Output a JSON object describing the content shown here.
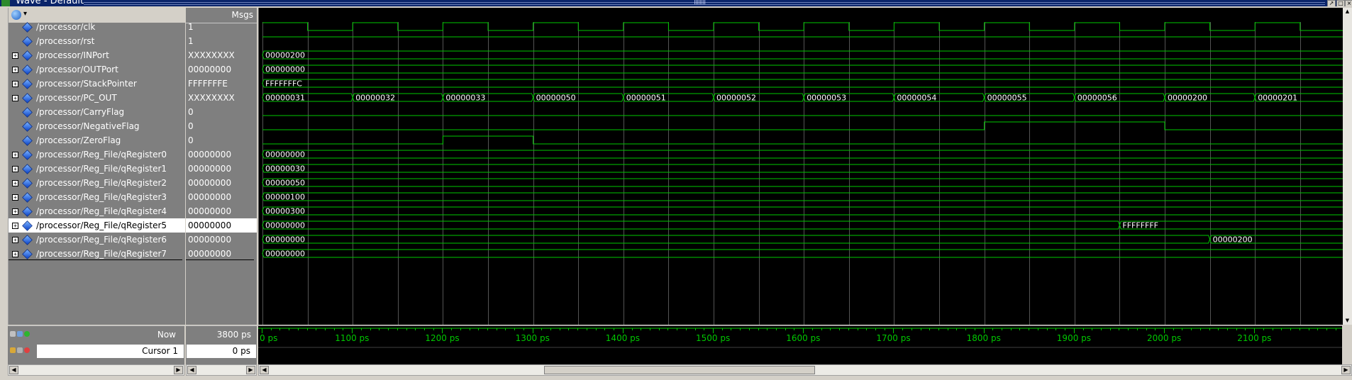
{
  "window": {
    "title": "Wave - Default"
  },
  "columns": {
    "values_header": "Msgs"
  },
  "signals": [
    {
      "name": "/processor/clk",
      "value": "1",
      "expandable": false
    },
    {
      "name": "/processor/rst",
      "value": "1",
      "expandable": false
    },
    {
      "name": "/processor/INPort",
      "value": "XXXXXXXX",
      "expandable": true
    },
    {
      "name": "/processor/OUTPort",
      "value": "00000000",
      "expandable": true
    },
    {
      "name": "/processor/StackPointer",
      "value": "FFFFFFFE",
      "expandable": true
    },
    {
      "name": "/processor/PC_OUT",
      "value": "XXXXXXXX",
      "expandable": true
    },
    {
      "name": "/processor/CarryFlag",
      "value": "0",
      "expandable": false
    },
    {
      "name": "/processor/NegativeFlag",
      "value": "0",
      "expandable": false
    },
    {
      "name": "/processor/ZeroFlag",
      "value": "0",
      "expandable": false
    },
    {
      "name": "/processor/Reg_File/qRegister0",
      "value": "00000000",
      "expandable": true
    },
    {
      "name": "/processor/Reg_File/qRegister1",
      "value": "00000000",
      "expandable": true
    },
    {
      "name": "/processor/Reg_File/qRegister2",
      "value": "00000000",
      "expandable": true
    },
    {
      "name": "/processor/Reg_File/qRegister3",
      "value": "00000000",
      "expandable": true
    },
    {
      "name": "/processor/Reg_File/qRegister4",
      "value": "00000000",
      "expandable": true
    },
    {
      "name": "/processor/Reg_File/qRegister5",
      "value": "00000000",
      "expandable": true,
      "selected": true
    },
    {
      "name": "/processor/Reg_File/qRegister6",
      "value": "00000000",
      "expandable": true
    },
    {
      "name": "/processor/Reg_File/qRegister7",
      "value": "00000000",
      "expandable": true
    }
  ],
  "waves": {
    "time_start_ps": 1000,
    "time_end_ps": 2150,
    "clock_period_ps": 100,
    "clk_high_first": true,
    "rst": "high",
    "buses": {
      "INPort": [
        {
          "t": 1000,
          "v": "00000200"
        }
      ],
      "OUTPort": [
        {
          "t": 1000,
          "v": "00000000"
        }
      ],
      "StackPointer": [
        {
          "t": 1000,
          "v": "FFFFFFFC"
        }
      ],
      "PC_OUT": [
        {
          "t": 1000,
          "v": "00000031"
        },
        {
          "t": 1100,
          "v": "00000032"
        },
        {
          "t": 1200,
          "v": "00000033"
        },
        {
          "t": 1300,
          "v": "00000050"
        },
        {
          "t": 1400,
          "v": "00000051"
        },
        {
          "t": 1500,
          "v": "00000052"
        },
        {
          "t": 1600,
          "v": "00000053"
        },
        {
          "t": 1700,
          "v": "00000054"
        },
        {
          "t": 1800,
          "v": "00000055"
        },
        {
          "t": 1900,
          "v": "00000056"
        },
        {
          "t": 2000,
          "v": "00000200"
        },
        {
          "t": 2100,
          "v": "00000201"
        }
      ],
      "qRegister0": [
        {
          "t": 1000,
          "v": "00000000"
        }
      ],
      "qRegister1": [
        {
          "t": 1000,
          "v": "00000030"
        }
      ],
      "qRegister2": [
        {
          "t": 1000,
          "v": "00000050"
        }
      ],
      "qRegister3": [
        {
          "t": 1000,
          "v": "00000100"
        }
      ],
      "qRegister4": [
        {
          "t": 1000,
          "v": "00000300"
        }
      ],
      "qRegister5": [
        {
          "t": 1000,
          "v": "00000000"
        },
        {
          "t": 1950,
          "v": "FFFFFFFF"
        }
      ],
      "qRegister6": [
        {
          "t": 1000,
          "v": "00000000"
        },
        {
          "t": 2050,
          "v": "00000200"
        }
      ],
      "qRegister7": [
        {
          "t": 1000,
          "v": "00000000"
        }
      ]
    },
    "bits": {
      "CarryFlag": [
        {
          "t": 1000,
          "v": 0
        }
      ],
      "NegativeFlag": [
        {
          "t": 1000,
          "v": 0
        },
        {
          "t": 1800,
          "v": 1
        },
        {
          "t": 2000,
          "v": 0
        }
      ],
      "ZeroFlag": [
        {
          "t": 1000,
          "v": 0
        },
        {
          "t": 1200,
          "v": 1
        },
        {
          "t": 1300,
          "v": 0
        }
      ]
    }
  },
  "timeline": {
    "labels": [
      "0 ps",
      "1100 ps",
      "1200 ps",
      "1300 ps",
      "1400 ps",
      "1500 ps",
      "1600 ps",
      "1700 ps",
      "1800 ps",
      "1900 ps",
      "2000 ps",
      "2100 ps"
    ]
  },
  "status": {
    "now_label": "Now",
    "now_value": "3800 ps",
    "cursor_label": "Cursor 1",
    "cursor_value": "0 ps"
  },
  "colors": {
    "wave": "#00c800",
    "grid": "#8c8c8c",
    "text": "#ffffff",
    "background": "#000000",
    "selected_row": "#ffffff"
  }
}
